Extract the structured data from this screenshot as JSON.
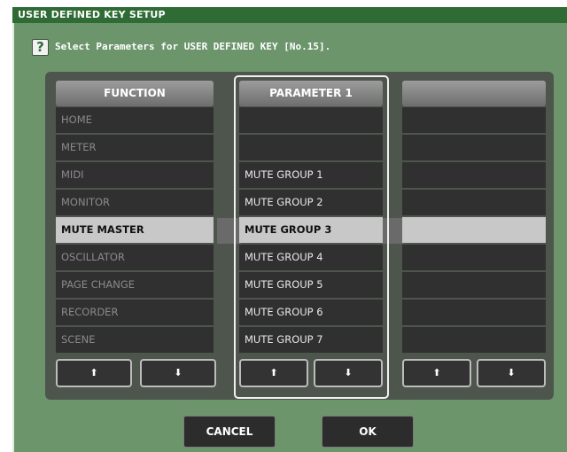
{
  "window": {
    "title": "USER DEFINED KEY SETUP"
  },
  "instruction": "Select Parameters for USER DEFINED KEY [No.15].",
  "help_icon_glyph": "?",
  "columns": {
    "function": {
      "header": "FUNCTION",
      "items": [
        "HOME",
        "METER",
        "MIDI",
        "MONITOR",
        "MUTE MASTER",
        "OSCILLATOR",
        "PAGE CHANGE",
        "RECORDER",
        "SCENE"
      ],
      "selected": "MUTE MASTER"
    },
    "parameter1": {
      "header": "PARAMETER 1",
      "items": [
        "",
        "",
        "MUTE GROUP 1",
        "MUTE GROUP 2",
        "MUTE GROUP 3",
        "MUTE GROUP 4",
        "MUTE GROUP 5",
        "MUTE GROUP 6",
        "MUTE GROUP 7"
      ],
      "selected": "MUTE GROUP 3"
    },
    "parameter2": {
      "header": "",
      "items": [
        "",
        "",
        "",
        "",
        "",
        "",
        "",
        "",
        ""
      ]
    }
  },
  "arrows": {
    "up": "⬆",
    "down": "⬇"
  },
  "buttons": {
    "cancel": "CANCEL",
    "ok": "OK"
  },
  "colors": {
    "background": "#6c956c",
    "title_bar": "#2f6b34",
    "selected_row": "#c8c8c8",
    "row": "#303030"
  }
}
